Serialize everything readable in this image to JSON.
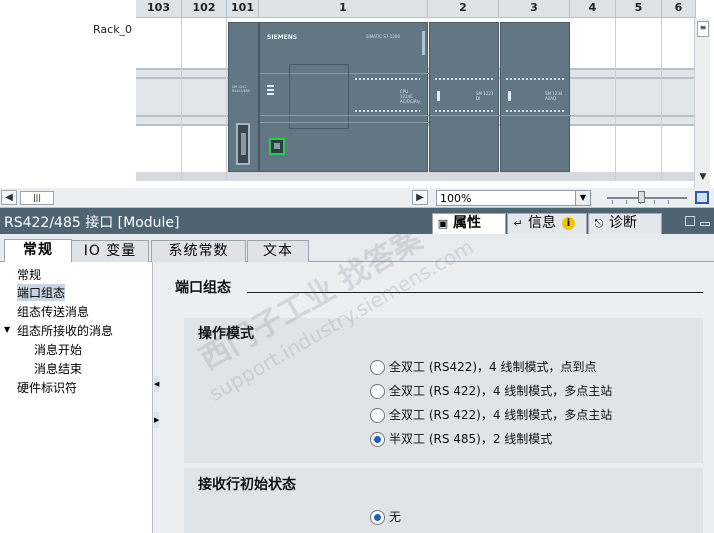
{
  "device_view": {
    "rack_label": "Rack_0",
    "slots": [
      "103",
      "102",
      "101",
      "1",
      "2",
      "3",
      "4",
      "5",
      "6"
    ],
    "cpu_brand": "SIEMENS",
    "cpu_model": "SIMATIC S7-1200",
    "cpu_type": "CPU 1214C AC/DC/Rly",
    "cm_label": "CM 1241 RS422/485",
    "sm1_label": "SM 1221 DI",
    "sm2_label": "SM 1234 AI/AQ"
  },
  "statusbar": {
    "zoom": "100%",
    "scroll_grip": "|||"
  },
  "inspector": {
    "title": "RS422/485 接口 [Module]",
    "tabs": [
      {
        "label": "属性",
        "icon": "properties-icon"
      },
      {
        "label": "信息",
        "icon": "info-icon"
      },
      {
        "label": "诊断",
        "icon": "diagnostics-icon"
      }
    ],
    "info_badge": "i"
  },
  "subtabs": [
    "常规",
    "IO 变量",
    "系统常数",
    "文本"
  ],
  "nav": {
    "items": [
      {
        "label": "常规"
      },
      {
        "label": "端口组态"
      },
      {
        "label": "组态传送消息"
      },
      {
        "label": "组态所接收的消息"
      },
      {
        "label": "消息开始"
      },
      {
        "label": "消息结束"
      },
      {
        "label": "硬件标识符"
      }
    ]
  },
  "content": {
    "section_title": "端口组态",
    "operating_mode": {
      "title": "操作模式",
      "options": [
        {
          "label": "全双工 (RS422)，4 线制模式，点到点",
          "checked": false
        },
        {
          "label": "全双工 (RS 422)，4 线制模式，多点主站",
          "checked": false
        },
        {
          "label": "全双工 (RS 422)，4 线制模式，多点主站",
          "checked": false
        },
        {
          "label": "半双工 (RS 485)，2 线制模式",
          "checked": true
        }
      ]
    },
    "receive_line": {
      "title": "接收行初始状态",
      "options": [
        {
          "label": "无",
          "checked": true
        }
      ]
    }
  },
  "colors": {
    "module": "#627683",
    "header_bar": "#4f6473",
    "accent": "#1d5fb4",
    "port_green": "#2ec84a"
  },
  "watermark": [
    "西门子工业  找答案",
    "support.industry.siemens.com"
  ]
}
